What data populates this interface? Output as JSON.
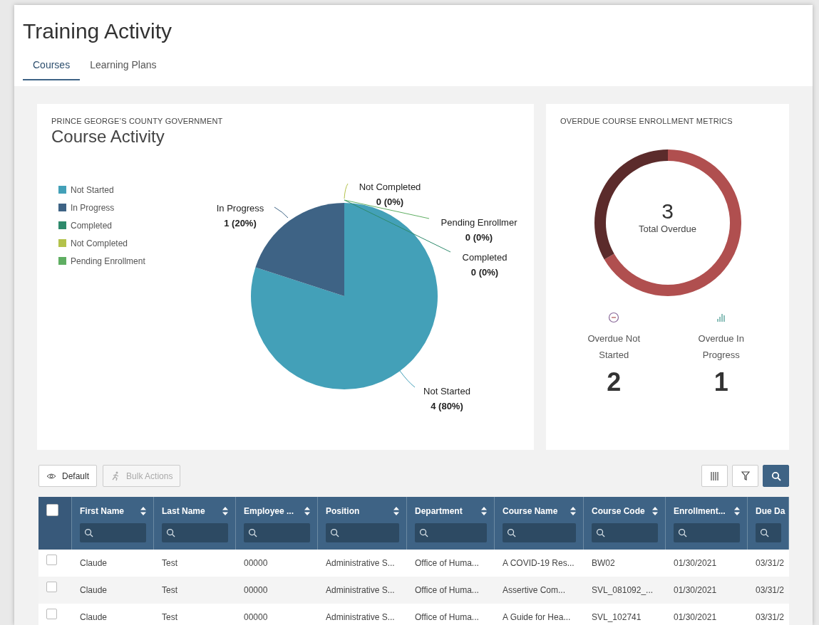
{
  "page": {
    "title": "Training Activity"
  },
  "tabs": [
    {
      "label": "Courses",
      "selected": true
    },
    {
      "label": "Learning Plans",
      "selected": false
    }
  ],
  "course_activity": {
    "subtitle": "PRINCE GEORGE’S COUNTY GOVERNMENT",
    "title": "Course Activity",
    "chart_data": {
      "type": "pie",
      "categories": [
        "Not Started",
        "In Progress",
        "Completed",
        "Not Completed",
        "Pending Enrollment"
      ],
      "values": [
        80,
        20,
        0,
        0,
        0
      ],
      "colors": [
        "#43a0b8",
        "#3e6385",
        "#2e8a6c",
        "#b3c24b",
        "#5fae62"
      ],
      "legend": "left"
    },
    "slice_labels": [
      {
        "name": "Not Started",
        "value": "4 (80%)"
      },
      {
        "name": "In Progress",
        "value": "1 (20%)"
      },
      {
        "name": "Completed",
        "value": "0 (0%)"
      },
      {
        "name": "Not Completed",
        "value": "0 (0%)"
      },
      {
        "name": "Pending Enrollmer",
        "value": "0 (0%)"
      }
    ]
  },
  "overdue": {
    "title": "OVERDUE COURSE ENROLLMENT METRICS",
    "total": "3",
    "total_label": "Total Overdue",
    "chart_data": {
      "type": "donut",
      "values": [
        66.67,
        33.33
      ],
      "colors": [
        "#b04f4f",
        "#5b2b2b"
      ]
    },
    "metrics": [
      {
        "kind": "not_started",
        "label": "Overdue Not Started",
        "value": "2"
      },
      {
        "kind": "in_progress",
        "label": "Overdue In Progress",
        "value": "1"
      }
    ]
  },
  "toolbar": {
    "left": [
      {
        "kind": "view",
        "label": "Default",
        "disabled": false
      },
      {
        "kind": "bulk",
        "label": "Bulk Actions",
        "disabled": true
      }
    ],
    "right": [
      {
        "kind": "columns",
        "selected": false
      },
      {
        "kind": "filter",
        "selected": false
      },
      {
        "kind": "search",
        "selected": true
      }
    ]
  },
  "table": {
    "all_checked": false,
    "columns": [
      {
        "label": "First Name",
        "sortable": true
      },
      {
        "label": "Last Name",
        "sortable": true
      },
      {
        "label": "Employee ...",
        "sortable": true
      },
      {
        "label": "Position",
        "sortable": true
      },
      {
        "label": "Department",
        "sortable": true
      },
      {
        "label": "Course Name",
        "sortable": true
      },
      {
        "label": "Course Code",
        "sortable": true
      },
      {
        "label": "Enrollment...",
        "sortable": true
      },
      {
        "label": "Due Da",
        "sortable": false
      }
    ],
    "rows": [
      {
        "checked": false,
        "cells": [
          "Claude",
          "Test",
          "00000",
          "Administrative S...",
          "Office of Huma...",
          "A COVID-19 Res...",
          "BW02",
          "01/30/2021",
          "03/31/2"
        ]
      },
      {
        "checked": false,
        "cells": [
          "Claude",
          "Test",
          "00000",
          "Administrative S...",
          "Office of Huma...",
          "Assertive Com...",
          "SVL_081092_...",
          "01/30/2021",
          "03/31/2"
        ]
      },
      {
        "checked": false,
        "cells": [
          "Claude",
          "Test",
          "00000",
          "Administrative S...",
          "Office of Huma...",
          "A Guide for Hea...",
          "SVL_102741",
          "01/30/2021",
          "03/31/2"
        ]
      }
    ]
  }
}
